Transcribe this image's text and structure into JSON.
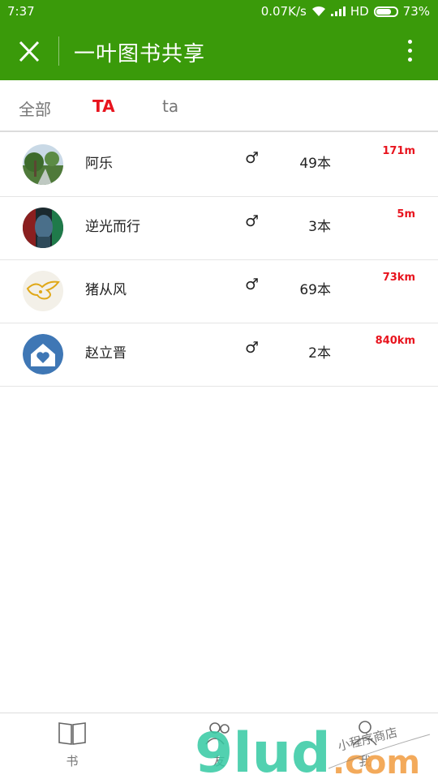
{
  "status_bar": {
    "time": "7:37",
    "speed": "0.07K/s",
    "network": "HD",
    "battery": "73%"
  },
  "header": {
    "title": "一叶图书共享"
  },
  "tabs": [
    {
      "label": "全部",
      "active": false
    },
    {
      "label": "TA",
      "active": true
    },
    {
      "label": "ta",
      "active": false
    }
  ],
  "users": [
    {
      "name": "阿乐",
      "gender": "♂",
      "books": "49本",
      "distance": "171m"
    },
    {
      "name": "逆光而行",
      "gender": "♂",
      "books": "3本",
      "distance": "5m"
    },
    {
      "name": "猪从风",
      "gender": "♂",
      "books": "69本",
      "distance": "73km"
    },
    {
      "name": "赵立晋",
      "gender": "♂",
      "books": "2本",
      "distance": "840km"
    }
  ],
  "bottom_nav": [
    {
      "label": "书",
      "icon": "book-icon"
    },
    {
      "label": "友",
      "icon": "friends-icon"
    },
    {
      "label": "我",
      "icon": "person-icon"
    }
  ],
  "watermark": {
    "brand": "9lud",
    "domain": ".com",
    "tagline": "小程序商店"
  },
  "colors": {
    "header_green": "#3a9a0a",
    "accent_red": "#e8141e"
  }
}
